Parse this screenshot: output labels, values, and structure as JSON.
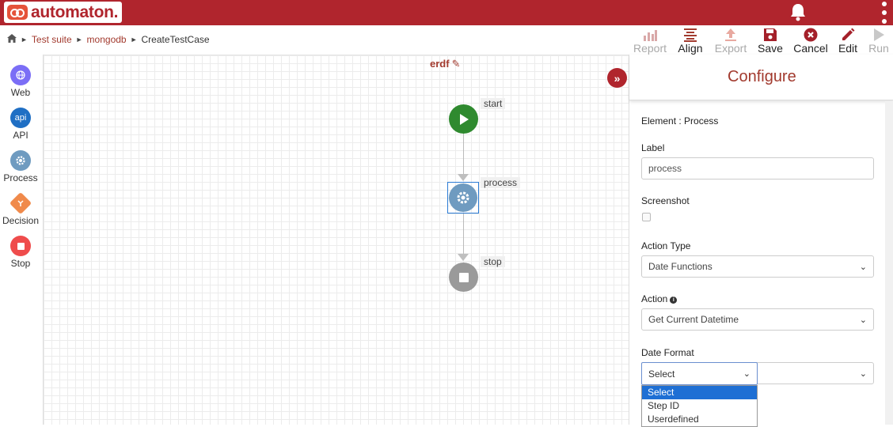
{
  "app": {
    "brand": "automaton.",
    "colors": {
      "primary": "#b0252d",
      "accent_text": "#a23a2e"
    }
  },
  "header": {
    "bell_icon": "bell-icon",
    "menu_icon": "kebab-menu-icon"
  },
  "breadcrumb": {
    "items": [
      "Test suite",
      "mongodb",
      "CreateTestCase"
    ]
  },
  "toolbar": {
    "report": "Report",
    "align": "Align",
    "export": "Export",
    "save": "Save",
    "cancel": "Cancel",
    "edit": "Edit",
    "run": "Run"
  },
  "palette": [
    {
      "label": "Web",
      "icon": "globe-icon",
      "color": "#7b6ef6"
    },
    {
      "label": "API",
      "icon": "api-icon",
      "color": "#1f6fc4",
      "glyph": "api"
    },
    {
      "label": "Process",
      "icon": "gear-icon",
      "color": "#6f9bc0"
    },
    {
      "label": "Decision",
      "icon": "decision-icon",
      "color": "#f08a4b"
    },
    {
      "label": "Stop",
      "icon": "stop-icon",
      "color": "#ef4c4c"
    }
  ],
  "flow": {
    "title": "erdf",
    "nodes": {
      "start": "start",
      "process": "process",
      "stop": "stop"
    }
  },
  "panel": {
    "title": "Configure",
    "element_text": "Element : Process",
    "label_field": {
      "label": "Label",
      "value": "process"
    },
    "screenshot": {
      "label": "Screenshot",
      "checked": false
    },
    "action_type": {
      "label": "Action Type",
      "value": "Date Functions"
    },
    "action": {
      "label": "Action",
      "value": "Get Current Datetime"
    },
    "date_format": {
      "label": "Date Format",
      "value": "Select",
      "options": [
        "Select",
        "Step ID",
        "Userdefined"
      ]
    }
  }
}
